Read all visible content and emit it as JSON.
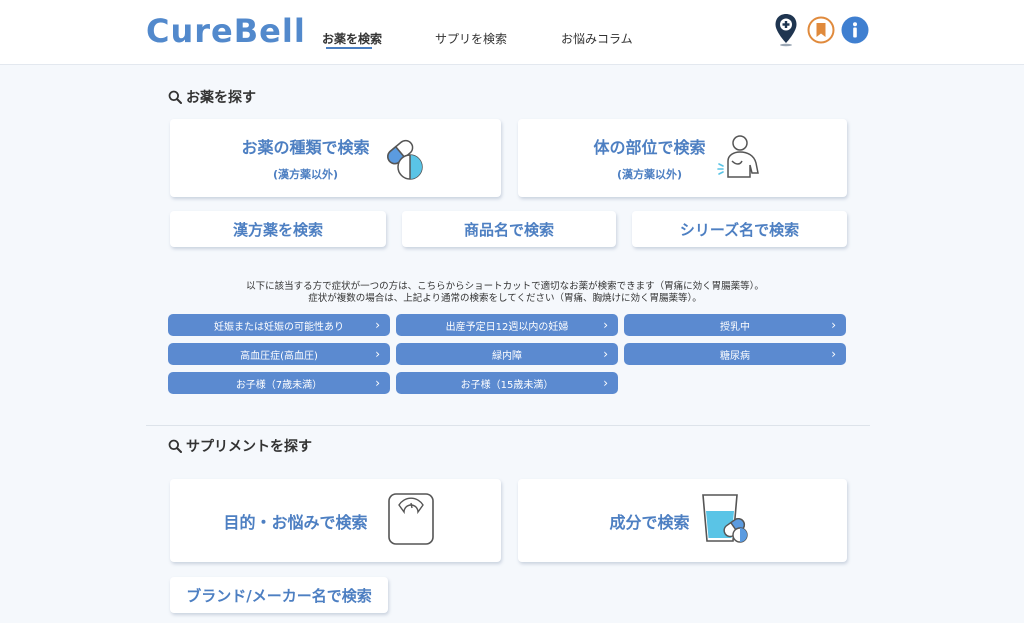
{
  "header": {
    "logo": "CureBell",
    "nav": [
      {
        "label": "お薬を検索"
      },
      {
        "label": "サプリを検索"
      },
      {
        "label": "お悩みコラム"
      }
    ],
    "icons": [
      "pharmacy-map-pin-icon",
      "bookmark-icon",
      "info-icon"
    ]
  },
  "medicine": {
    "title": "お薬を探す",
    "card_type": {
      "main": "お薬の種類で検索",
      "sub": "(漢方薬以外)"
    },
    "card_body": {
      "main": "体の部位で検索",
      "sub": "(漢方薬以外)"
    },
    "btn_kampo": "漢方薬を検索",
    "btn_product": "商品名で検索",
    "btn_series": "シリーズ名で検索",
    "notice_line1": "以下に該当する方で症状が一つの方は、こちらからショートカットで適切なお薬が検索できます（胃痛に効く胃腸薬等）。",
    "notice_line2": "症状が複数の場合は、上記より通常の検索をしてください（胃痛、胸焼けに効く胃腸薬等）。",
    "pills": [
      "妊娠または妊娠の可能性あり",
      "出産予定日12週以内の妊婦",
      "授乳中",
      "高血圧症(高血圧)",
      "緑内障",
      "糖尿病",
      "お子様（7歳未満）",
      "お子様（15歳未満）"
    ]
  },
  "supplement": {
    "title": "サプリメントを探す",
    "card_purpose": "目的・お悩みで検索",
    "card_ingredient": "成分で検索",
    "btn_brand": "ブランド/メーカー名で検索"
  },
  "colors": {
    "accent": "#5289cc",
    "pill": "#5b8ad0",
    "bookmark": "#e08a3c",
    "info": "#3f7fd0",
    "pin": "#1f3550"
  }
}
